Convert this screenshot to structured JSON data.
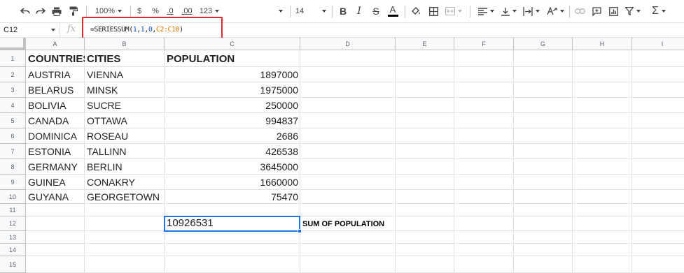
{
  "toolbar": {
    "zoom": "100%",
    "currency": "$",
    "percent": "%",
    "decrease_decimal": ".0",
    "increase_decimal": ".00",
    "more_formats": "123",
    "font_size": "14"
  },
  "formula_bar": {
    "name_box": "C12",
    "fx": "fx",
    "formula_parts": [
      "=SERIESSUM(",
      "1",
      ",",
      "1",
      ",",
      "0",
      ",",
      "C2:C10",
      ")"
    ]
  },
  "columns": [
    "A",
    "B",
    "C",
    "D",
    "E",
    "F",
    "G",
    "H",
    "I"
  ],
  "rows": [
    "1",
    "2",
    "3",
    "4",
    "5",
    "6",
    "7",
    "8",
    "9",
    "10",
    "11",
    "12",
    "13",
    "14",
    "15"
  ],
  "table": {
    "headers": [
      "COUNTRIES",
      "CITIES",
      "POPULATION"
    ],
    "records": [
      [
        "AUSTRIA",
        "VIENNA",
        "1897000"
      ],
      [
        "BELARUS",
        "MINSK",
        "1975000"
      ],
      [
        "BOLIVIA",
        "SUCRE",
        "250000"
      ],
      [
        "CANADA",
        "OTTAWA",
        "994837"
      ],
      [
        "DOMINICA",
        "ROSEAU",
        "2686"
      ],
      [
        "ESTONIA",
        "TALLINN",
        "426538"
      ],
      [
        "GERMANY",
        "BERLIN",
        "3645000"
      ],
      [
        "GUINEA",
        "CONAKRY",
        "1660000"
      ],
      [
        "GUYANA",
        "GEORGETOWN",
        "75470"
      ]
    ]
  },
  "result": {
    "value": "10926531",
    "note": "SUM OF POPULATION"
  }
}
